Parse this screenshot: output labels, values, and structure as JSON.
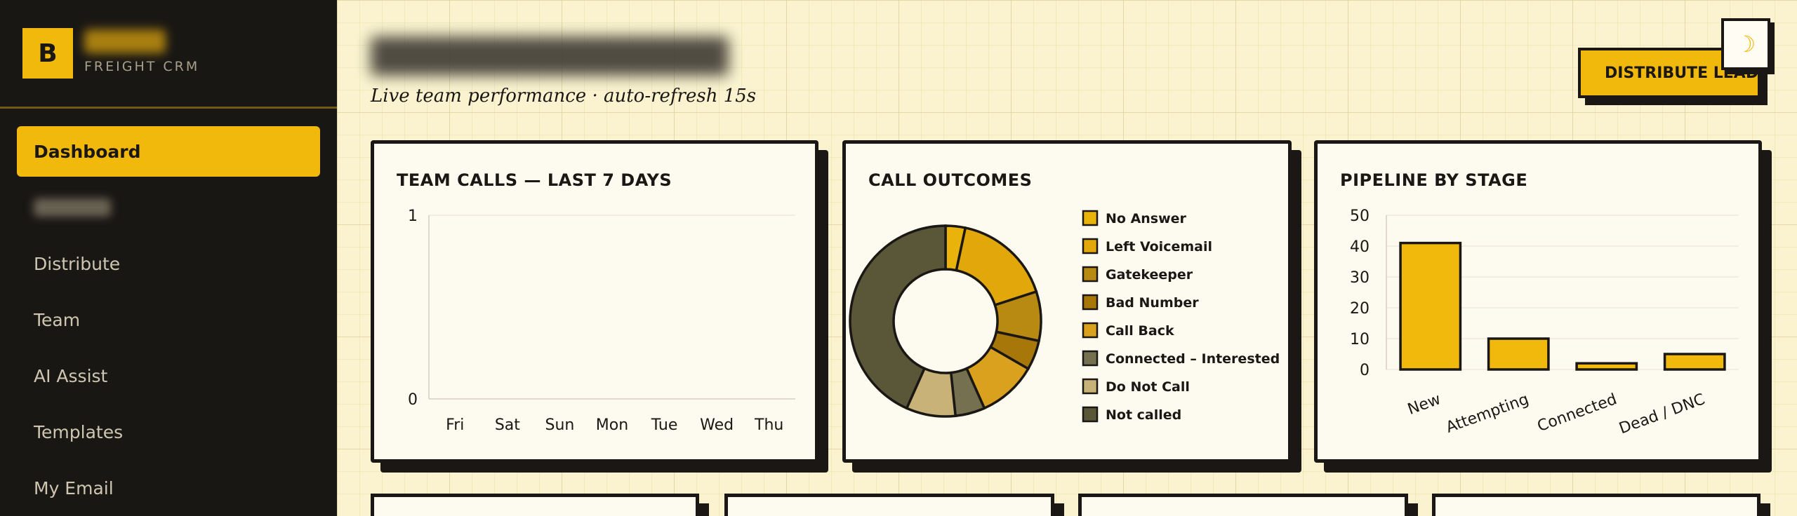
{
  "brand": {
    "logo_letter": "B",
    "subtitle": "FREIGHT CRM"
  },
  "sidebar": {
    "items": [
      {
        "label": "Dashboard",
        "active": true
      },
      {
        "label": "",
        "blurred": true
      },
      {
        "label": "Distribute"
      },
      {
        "label": "Team"
      },
      {
        "label": "AI Assist"
      },
      {
        "label": "Templates"
      },
      {
        "label": "My Email"
      }
    ]
  },
  "header": {
    "subtitle": "Live team performance · auto-refresh 15s",
    "distribute_label": "DISTRIBUTE LEADS",
    "theme_icon": "moon-icon"
  },
  "colors": {
    "accent": "#f2b90d",
    "sidebar_bg": "#191714",
    "page_bg": "#fbf3cf",
    "ink": "#1a1714"
  },
  "cards": {
    "team_calls_title": "TEAM CALLS — LAST 7 DAYS",
    "call_outcomes_title": "CALL OUTCOMES",
    "pipeline_title": "PIPELINE BY STAGE"
  },
  "chart_data": [
    {
      "type": "line",
      "title": "TEAM CALLS — LAST 7 DAYS",
      "categories": [
        "Fri",
        "Sat",
        "Sun",
        "Mon",
        "Tue",
        "Wed",
        "Thu"
      ],
      "ylim": [
        0,
        1
      ],
      "yticks": [
        "0",
        "1"
      ],
      "series": [],
      "grid": true
    },
    {
      "type": "pie",
      "title": "CALL OUTCOMES",
      "legend_position": "right",
      "slices": [
        {
          "label": "No Answer",
          "value": 2,
          "color": "#eab30c"
        },
        {
          "label": "Left Voicemail",
          "value": 10,
          "color": "#e2a80b"
        },
        {
          "label": "Gatekeeper",
          "value": 5,
          "color": "#b98a12"
        },
        {
          "label": "Bad Number",
          "value": 3,
          "color": "#a8770a"
        },
        {
          "label": "Call Back",
          "value": 6,
          "color": "#d9a11d"
        },
        {
          "label": "Connected – Interested",
          "value": 3,
          "color": "#747050"
        },
        {
          "label": "Do Not Call",
          "value": 5,
          "color": "#c9b277"
        },
        {
          "label": "Not called",
          "value": 26,
          "color": "#5a5638"
        }
      ]
    },
    {
      "type": "bar",
      "title": "PIPELINE BY STAGE",
      "categories": [
        "New",
        "Attempting",
        "Connected",
        "Dead / DNC"
      ],
      "values": [
        41,
        10,
        2,
        5
      ],
      "ylim": [
        0,
        50
      ],
      "yticks": [
        "0",
        "10",
        "20",
        "30",
        "40",
        "50"
      ],
      "color": "#f2b90d",
      "grid": true
    }
  ]
}
